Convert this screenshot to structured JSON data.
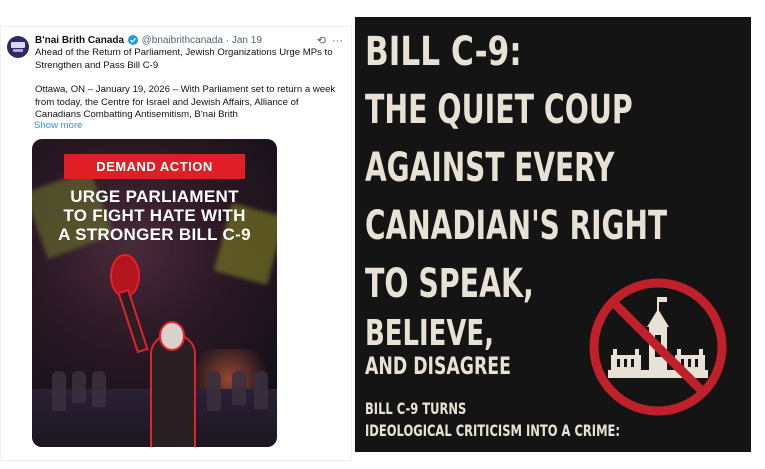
{
  "tweet": {
    "author": "B'nai Brith Canada",
    "handle": "@bnaibrithcanada",
    "separator": "·",
    "date": "Jan 19",
    "text_p1": "Ahead of the Return of Parliament, Jewish Organizations Urge MPs to Strengthen and Pass Bill C-9",
    "text_p2": "Ottawa, ON – January 19, 2026 – With Parliament set to return a week from today, the Centre for Israel and Jewish Affairs, Alliance of Canadians Combatting Antisemitism, B'nai Brith",
    "show_more": "Show more",
    "icons": [
      "grok-icon",
      "more-icon"
    ],
    "media": {
      "banner": "DEMAND ACTION",
      "headline_lines": [
        "URGE PARLIAMENT",
        "TO FIGHT HATE WITH",
        "A STRONGER BILL C-9"
      ]
    }
  },
  "poster": {
    "lines": [
      "BILL C-9:",
      "THE QUIET COUP",
      "AGAINST EVERY",
      "CANADIAN'S RIGHT",
      "TO SPEAK,",
      "BELIEVE,",
      "AND DISAGREE",
      "BILL C-9 TURNS",
      "IDEOLOGICAL CRITICISM INTO A CRIME:"
    ],
    "colors": {
      "text": "#e8e1d5",
      "background": "#141414",
      "sign": "#c0202a"
    }
  }
}
